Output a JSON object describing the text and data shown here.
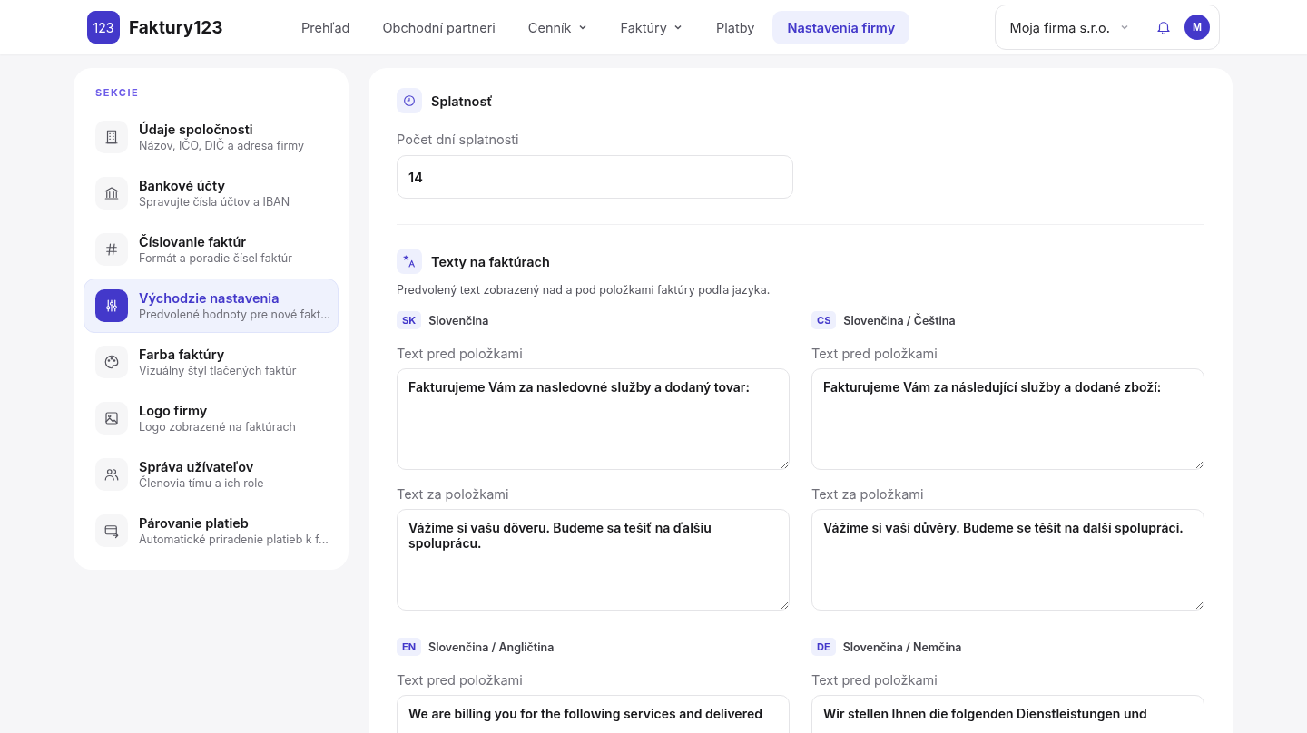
{
  "header": {
    "logo_mark": "123",
    "brand": "Faktury123",
    "nav": [
      {
        "label": "Prehľad",
        "dropdown": false,
        "selected": false
      },
      {
        "label": "Obchodní partneri",
        "dropdown": false,
        "selected": false
      },
      {
        "label": "Cenník",
        "dropdown": true,
        "selected": false
      },
      {
        "label": "Faktúry",
        "dropdown": true,
        "selected": false
      },
      {
        "label": "Platby",
        "dropdown": false,
        "selected": false
      },
      {
        "label": "Nastavenia firmy",
        "dropdown": false,
        "selected": true
      }
    ],
    "company": "Moja firma s.r.o.",
    "avatar": "M"
  },
  "sidebar": {
    "heading": "SEKCIE",
    "items": [
      {
        "title": "Údaje spoločnosti",
        "subtitle": "Názov, IČO, DIČ a adresa firmy",
        "selected": false
      },
      {
        "title": "Bankové účty",
        "subtitle": "Spravujte čísla účtov a IBAN",
        "selected": false
      },
      {
        "title": "Číslovanie faktúr",
        "subtitle": "Formát a poradie čísel faktúr",
        "selected": false
      },
      {
        "title": "Východzie nastavenia",
        "subtitle": "Predvolené hodnoty pre nové fakt...",
        "selected": true
      },
      {
        "title": "Farba faktúry",
        "subtitle": "Vizuálny štýl tlačených faktúr",
        "selected": false
      },
      {
        "title": "Logo firmy",
        "subtitle": "Logo zobrazené na faktúrach",
        "selected": false
      },
      {
        "title": "Správa užívateľov",
        "subtitle": "Členovia tímu a ich role",
        "selected": false
      },
      {
        "title": "Párovanie platieb",
        "subtitle": "Automatické priradenie platieb k f...",
        "selected": false
      }
    ]
  },
  "due": {
    "title": "Splatnosť",
    "label": "Počet dní splatnosti",
    "value": "14"
  },
  "texts": {
    "title": "Texty na faktúrach",
    "description": "Predvolený text zobrazený nad a pod položkami faktúry podľa jazyka.",
    "languages": [
      {
        "code": "SK",
        "name": "Slovenčina",
        "fields": [
          {
            "label": "Text pred položkami",
            "value": "Fakturujeme Vám za nasledovné služby a dodaný tovar:"
          },
          {
            "label": "Text za položkami",
            "value": "Vážime si vašu dôveru. Budeme sa tešiť na ďalšiu spoluprácu."
          }
        ]
      },
      {
        "code": "CS",
        "name": "Slovenčina / Čeština",
        "fields": [
          {
            "label": "Text pred položkami",
            "value": "Fakturujeme Vám za následující služby a dodané zboží:"
          },
          {
            "label": "Text za položkami",
            "value": "Vážíme si vaší důvěry. Budeme se těšit na další spolupráci."
          }
        ]
      },
      {
        "code": "EN",
        "name": "Slovenčina / Angličtina",
        "fields": [
          {
            "label": "Text pred položkami",
            "value": "We are billing you for the following services and delivered"
          }
        ]
      },
      {
        "code": "DE",
        "name": "Slovenčina / Nemčina",
        "fields": [
          {
            "label": "Text pred položkami",
            "value": "Wir stellen Ihnen die folgenden Dienstleistungen und"
          }
        ]
      }
    ]
  }
}
